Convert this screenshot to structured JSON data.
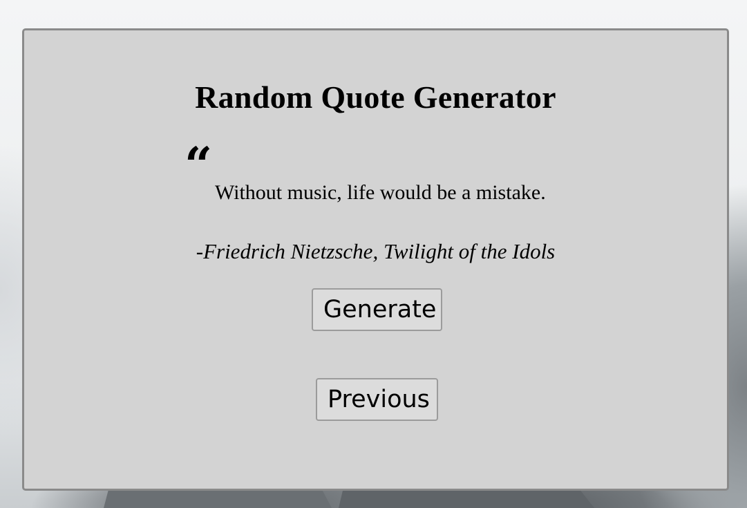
{
  "app": {
    "title": "Random Quote Generator"
  },
  "quote": {
    "mark": "“",
    "text": "Without music, life would be a mistake.",
    "attribution": "-Friedrich Nietzsche, Twilight of the Idols"
  },
  "buttons": {
    "generate_label": "Generate",
    "previous_label": "Previous"
  },
  "colors": {
    "card_background": "#d3d3d3",
    "card_border": "#8a8a8a",
    "button_background": "#dcdcdc",
    "text": "#000000"
  },
  "icons": {
    "quote": "quote-mark-icon"
  }
}
